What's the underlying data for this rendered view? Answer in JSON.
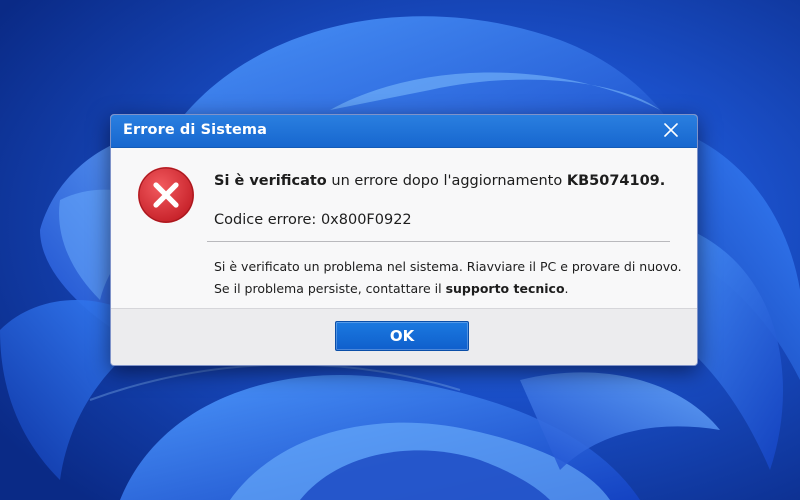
{
  "dialog": {
    "title": "Errore di Sistema",
    "close_icon": "close-icon",
    "error_icon": "error-x-circle-icon",
    "headline": {
      "bold_lead": "Si è verificato",
      "middle": " un errore dopo l'aggiornamento ",
      "bold_kb": "KB5074109."
    },
    "code": {
      "label": "Codice errore: ",
      "value": "0x800F0922"
    },
    "message": {
      "line1": "Si è verificato un problema nel sistema. Riavviare il PC e provare di nuovo.",
      "line2_prefix": "Se il problema persiste, contattare il ",
      "line2_bold": "supporto tecnico",
      "line2_suffix": "."
    },
    "ok_label": "OK"
  },
  "colors": {
    "title_bar": "#1767cf",
    "ok_button": "#0f5fcc",
    "error_red": "#d8242c",
    "wallpaper": "#0d2f8f"
  }
}
